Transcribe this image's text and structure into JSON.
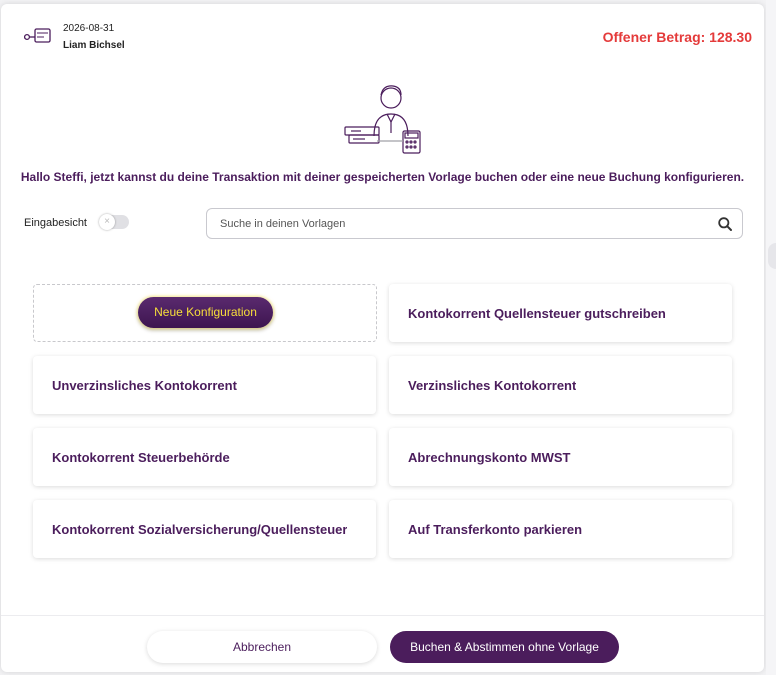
{
  "header": {
    "date": "2026-08-31",
    "user": "Liam Bichsel",
    "amount": "Offener Betrag: 128.30"
  },
  "greeting": "Hallo Steffi, jetzt kannst du deine Transaktion mit deiner gespeicherten Vorlage buchen oder eine neue Buchung konfigurieren.",
  "toggle": {
    "label": "Eingabesicht",
    "checked": false
  },
  "search": {
    "placeholder": "Suche in deinen Vorlagen",
    "value": ""
  },
  "new_config_label": "Neue Konfiguration",
  "templates": [
    "Kontokorrent Quellensteuer gutschreiben",
    "Unverzinsliches Kontokorrent",
    "Verzinsliches Kontokorrent",
    "Kontokorrent Steuerbehörde",
    "Abrechnungskonto MWST",
    "Kontokorrent Sozialversicherung/Quellensteuer",
    "Auf Transferkonto parkieren"
  ],
  "footer": {
    "cancel_label": "Abbrechen",
    "book_label": "Buchen & Abstimmen ohne Vorlage"
  },
  "colors": {
    "primary": "#4b1d5c",
    "amount": "#e43a3a",
    "highlight": "#f7df3a"
  }
}
